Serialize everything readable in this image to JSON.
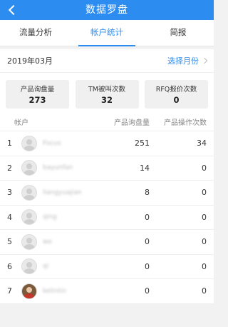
{
  "header": {
    "title": "数据罗盘"
  },
  "tabs": [
    {
      "label": "流量分析",
      "active": false
    },
    {
      "label": "帐户统计",
      "active": true
    },
    {
      "label": "简报",
      "active": false
    }
  ],
  "date_bar": {
    "date": "2019年03月",
    "choose_label": "选择月份"
  },
  "stats": [
    {
      "label": "产品询盘量",
      "value": "273"
    },
    {
      "label": "TM被叫次数",
      "value": "32"
    },
    {
      "label": "RFQ报价次数",
      "value": "0"
    }
  ],
  "table": {
    "headers": {
      "account": "帐户",
      "inquiries": "产品询盘量",
      "operations": "产品操作次数"
    },
    "rows": [
      {
        "index": "1",
        "name": "Focus",
        "inquiries": "251",
        "operations": "34"
      },
      {
        "index": "2",
        "name": "bayunfan",
        "inquiries": "14",
        "operations": "0"
      },
      {
        "index": "3",
        "name": "liangyuajian",
        "inquiries": "8",
        "operations": "0"
      },
      {
        "index": "4",
        "name": "qing",
        "inquiries": "0",
        "operations": "0"
      },
      {
        "index": "5",
        "name": "we",
        "inquiries": "0",
        "operations": "0"
      },
      {
        "index": "6",
        "name": "qi",
        "inquiries": "0",
        "operations": "0"
      },
      {
        "index": "7",
        "name": "kelintin",
        "inquiries": "0",
        "operations": "0"
      }
    ]
  },
  "colors": {
    "accent": "#2d8cf0"
  },
  "icons": {
    "back": "chevron-left-icon",
    "choose": "chevron-right-icon",
    "avatar": "user-avatar-icon"
  }
}
